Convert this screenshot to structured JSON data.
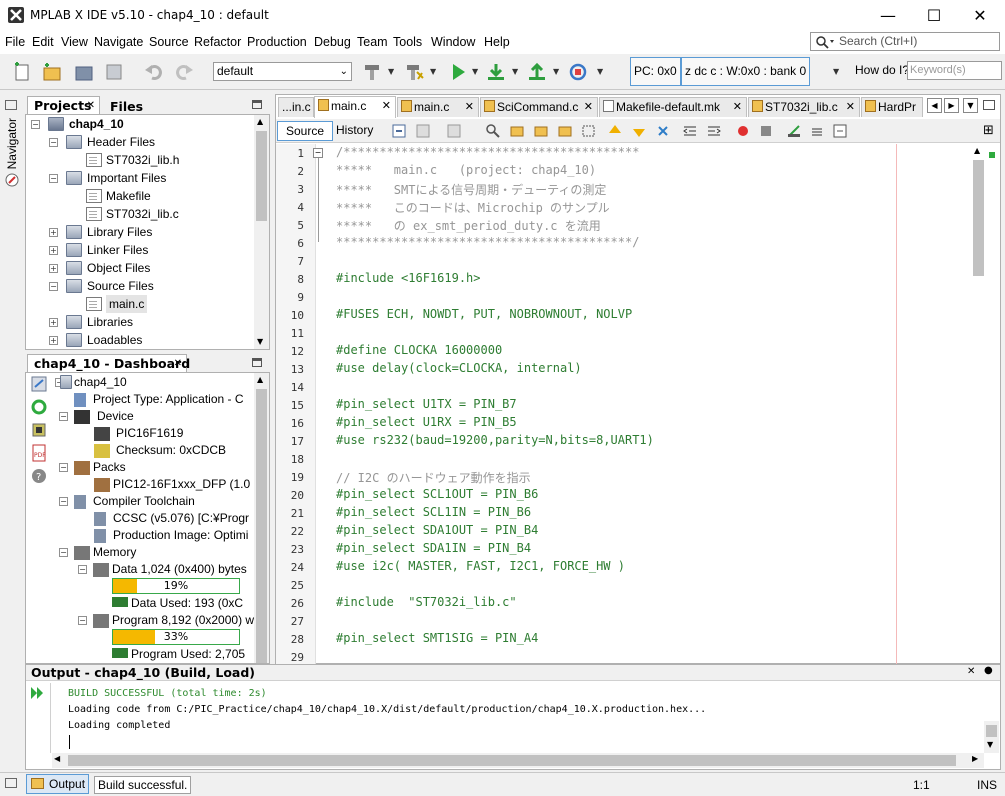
{
  "window": {
    "title": "MPLAB X IDE v5.10 - chap4_10 : default"
  },
  "menu": [
    "File",
    "Edit",
    "View",
    "Navigate",
    "Source",
    "Refactor",
    "Production",
    "Debug",
    "Team",
    "Tools",
    "Window",
    "Help"
  ],
  "search": {
    "placeholder": "Search (Ctrl+I)"
  },
  "toolbar": {
    "config": "default",
    "pc": "PC: 0x0",
    "status_regs": "z dc c  : W:0x0 : bank 0",
    "howdo": "How do I?",
    "keyword_placeholder": "Keyword(s)"
  },
  "sidestrip": {
    "navigator": "Navigator"
  },
  "projects": {
    "tab_projects": "Projects",
    "tab_files": "Files",
    "tree": [
      "chap4_10",
      "Header Files",
      "ST7032i_lib.h",
      "Important Files",
      "Makefile",
      "ST7032i_lib.c",
      "Library Files",
      "Linker Files",
      "Object Files",
      "Source Files",
      "main.c",
      "Libraries",
      "Loadables"
    ]
  },
  "dashboard": {
    "title": "chap4_10 - Dashboard",
    "rows": [
      "chap4_10",
      "Project Type: Application - C",
      "Device",
      "PIC16F1619",
      "Checksum: 0xCDCB",
      "Packs",
      "PIC12-16F1xxx_DFP (1.0",
      "Compiler Toolchain",
      "CCSC (v5.076) [C:¥Progr",
      "Production Image: Optimi",
      "Memory",
      "Data 1,024 (0x400) bytes",
      "Data Used: 193 (0xC",
      "Program 8,192 (0x2000) w",
      "Program Used: 2,705"
    ],
    "data_pct": "19%",
    "data_frac": 0.19,
    "prog_pct": "33%",
    "prog_frac": 0.33
  },
  "editor": {
    "tabs": [
      "...in.c",
      "main.c",
      "main.c",
      "SciCommand.c",
      "Makefile-default.mk",
      "ST7032i_lib.c",
      "HardPr"
    ],
    "source_btn": "Source",
    "history_btn": "History",
    "lines": [
      {
        "n": "1",
        "t": "/*****************************************"
      },
      {
        "n": "2",
        "t": "*****   main.c   (project: chap4_10)"
      },
      {
        "n": "3",
        "t": "*****   SMTによる信号周期・デューティの測定"
      },
      {
        "n": "4",
        "t": "*****   このコードは、Microchip のサンプル"
      },
      {
        "n": "5",
        "t": "*****   の ex_smt_period_duty.c を流用"
      },
      {
        "n": "6",
        "t": "*****************************************/"
      },
      {
        "n": "7",
        "t": ""
      },
      {
        "n": "8",
        "t": "#include <16F1619.h>"
      },
      {
        "n": "9",
        "t": ""
      },
      {
        "n": "10",
        "t": "#FUSES ECH, NOWDT, PUT, NOBROWNOUT, NOLVP"
      },
      {
        "n": "11",
        "t": ""
      },
      {
        "n": "12",
        "t": "#define CLOCKA 16000000"
      },
      {
        "n": "13",
        "t": "#use delay(clock=CLOCKA, internal)"
      },
      {
        "n": "14",
        "t": ""
      },
      {
        "n": "15",
        "t": "#pin_select U1TX = PIN_B7"
      },
      {
        "n": "16",
        "t": "#pin_select U1RX = PIN_B5"
      },
      {
        "n": "17",
        "t": "#use rs232(baud=19200,parity=N,bits=8,UART1)"
      },
      {
        "n": "18",
        "t": ""
      },
      {
        "n": "19",
        "t": "// I2C のハードウェア動作を指示"
      },
      {
        "n": "20",
        "t": "#pin_select SCL1OUT = PIN_B6"
      },
      {
        "n": "21",
        "t": "#pin_select SCL1IN = PIN_B6"
      },
      {
        "n": "22",
        "t": "#pin_select SDA1OUT = PIN_B4"
      },
      {
        "n": "23",
        "t": "#pin_select SDA1IN = PIN_B4"
      },
      {
        "n": "24",
        "t": "#use i2c( MASTER, FAST, I2C1, FORCE_HW )"
      },
      {
        "n": "25",
        "t": ""
      },
      {
        "n": "26",
        "t": "#include  \"ST7032i_lib.c\""
      },
      {
        "n": "27",
        "t": ""
      },
      {
        "n": "28",
        "t": "#pin_select SMT1SIG = PIN_A4"
      },
      {
        "n": "29",
        "t": ""
      }
    ]
  },
  "output": {
    "title": "Output - chap4_10 (Build, Load)",
    "lines": [
      "BUILD SUCCESSFUL (total time: 2s)",
      "Loading code from C:/PIC_Practice/chap4_10/chap4_10.X/dist/default/production/chap4_10.X.production.hex...",
      "Loading completed"
    ]
  },
  "status": {
    "output_tab": "Output",
    "message": "Build successful.",
    "position": "1:1",
    "mode": "INS"
  },
  "colors": {
    "accent": "#5b9bd5",
    "green": "#2e9e3e",
    "comment": "#969696"
  }
}
